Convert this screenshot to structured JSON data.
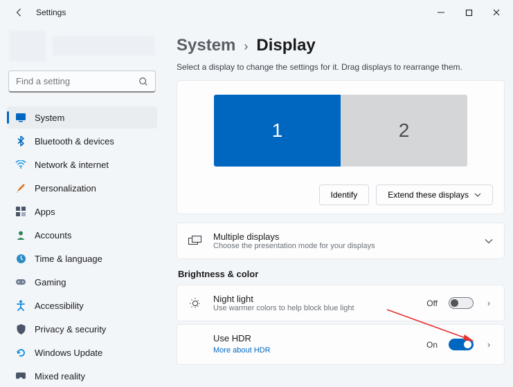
{
  "window": {
    "title": "Settings"
  },
  "search": {
    "placeholder": "Find a setting"
  },
  "nav": {
    "items": [
      {
        "label": "System"
      },
      {
        "label": "Bluetooth & devices"
      },
      {
        "label": "Network & internet"
      },
      {
        "label": "Personalization"
      },
      {
        "label": "Apps"
      },
      {
        "label": "Accounts"
      },
      {
        "label": "Time & language"
      },
      {
        "label": "Gaming"
      },
      {
        "label": "Accessibility"
      },
      {
        "label": "Privacy & security"
      },
      {
        "label": "Windows Update"
      },
      {
        "label": "Mixed reality"
      }
    ]
  },
  "breadcrumb": {
    "parent": "System",
    "current": "Display"
  },
  "subtitle": "Select a display to change the settings for it. Drag displays to rearrange them.",
  "monitors": {
    "m1": "1",
    "m2": "2"
  },
  "buttons": {
    "identify": "Identify",
    "extend": "Extend these displays"
  },
  "multiple": {
    "title": "Multiple displays",
    "desc": "Choose the presentation mode for your displays"
  },
  "section": {
    "brightness": "Brightness & color"
  },
  "nightlight": {
    "title": "Night light",
    "desc": "Use warmer colors to help block blue light",
    "state": "Off"
  },
  "hdr": {
    "title": "Use HDR",
    "link": "More about HDR",
    "state": "On"
  }
}
